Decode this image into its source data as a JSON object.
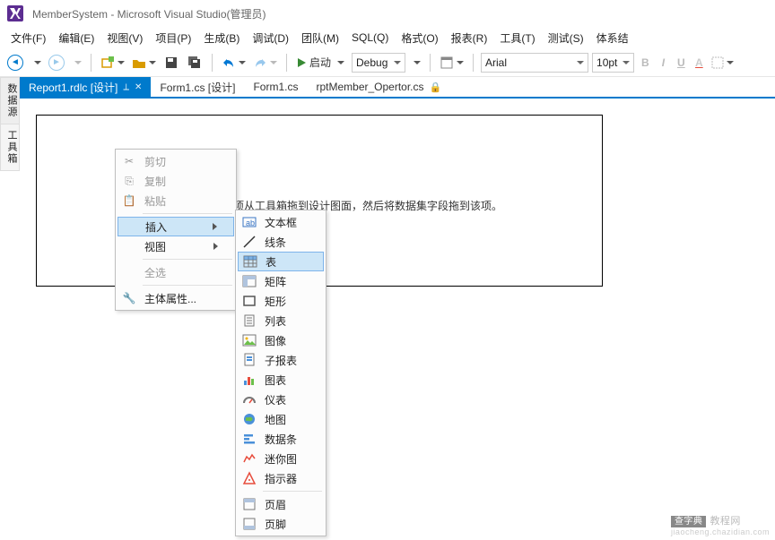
{
  "title": "MemberSystem - Microsoft Visual Studio(管理员)",
  "menu": [
    "文件(F)",
    "编辑(E)",
    "视图(V)",
    "项目(P)",
    "生成(B)",
    "调试(D)",
    "团队(M)",
    "SQL(Q)",
    "格式(O)",
    "报表(R)",
    "工具(T)",
    "测试(S)",
    "体系结"
  ],
  "toolbar": {
    "start_label": "启动",
    "config": "Debug",
    "font_family": "Arial",
    "font_size": "10pt",
    "bold": "B",
    "italic": "I",
    "underline": "U",
    "fontcolor": "A"
  },
  "tabs": [
    {
      "label": "Report1.rdlc [设计]",
      "active": true,
      "pinned": true
    },
    {
      "label": "Form1.cs [设计]",
      "active": false
    },
    {
      "label": "Form1.cs",
      "active": false
    },
    {
      "label": "rptMember_Opertor.cs",
      "active": false,
      "locked": true
    }
  ],
  "side_rails": {
    "datasource": "数据源",
    "toolbox": "工具箱"
  },
  "designer_hint": "项从工具箱拖到设计图面，然后将数据集字段拖到该项。",
  "context_menu": {
    "cut": "剪切",
    "copy": "复制",
    "paste": "粘贴",
    "insert": "插入",
    "view": "视图",
    "selectall": "全选",
    "bodyprops": "主体属性..."
  },
  "insert_submenu": [
    {
      "icon": "textbox",
      "label": "文本框"
    },
    {
      "icon": "line",
      "label": "线条"
    },
    {
      "icon": "table",
      "label": "表",
      "highlight": true
    },
    {
      "icon": "matrix",
      "label": "矩阵"
    },
    {
      "icon": "rect",
      "label": "矩形"
    },
    {
      "icon": "list",
      "label": "列表"
    },
    {
      "icon": "image",
      "label": "图像"
    },
    {
      "icon": "subreport",
      "label": "子报表"
    },
    {
      "icon": "chart",
      "label": "图表"
    },
    {
      "icon": "gauge",
      "label": "仪表"
    },
    {
      "icon": "map",
      "label": "地图"
    },
    {
      "icon": "databar",
      "label": "数据条"
    },
    {
      "icon": "sparkline",
      "label": "迷你图"
    },
    {
      "icon": "indicator",
      "label": "指示器"
    },
    {
      "sep": true
    },
    {
      "icon": "header",
      "label": "页眉"
    },
    {
      "icon": "footer",
      "label": "页脚"
    }
  ],
  "watermark": {
    "badge": "查字典",
    "text": "教程网",
    "url": "jiaocheng.chazidian.com"
  }
}
